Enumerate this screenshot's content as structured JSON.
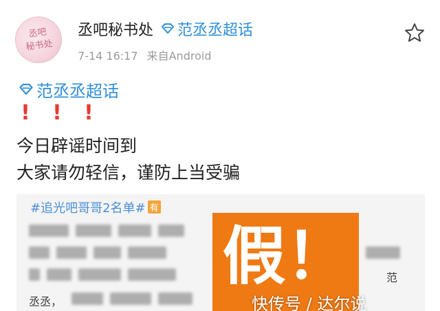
{
  "post": {
    "username": "丞吧秘书处",
    "topic_inline": "范丞丞超话",
    "time": "7-14 16:17",
    "source": "来自Android",
    "avatar_text": [
      "丞吧",
      "秘书处"
    ],
    "topic_tag": "范丞丞超话",
    "alert_marks": [
      "!",
      "!",
      "!"
    ],
    "lines": [
      "今日辟谣时间到",
      "大家请勿轻信，谨防上当受骗"
    ]
  },
  "image": {
    "title": "#追光吧哥哥2名单#",
    "badge": "有",
    "fan_text_right": "范",
    "fan_text_left": "丞丞，",
    "stamp_text": "假！",
    "stamp_color": "#ef7a14",
    "watermark": "快传号 / 达尔说"
  },
  "colors": {
    "accent_blue": "#2f8fd8",
    "alert_red": "#e53b34",
    "meta_gray": "#9a9a9a"
  },
  "icons": {
    "topic": "diamond-topic-icon",
    "favorite": "star-outline-icon"
  }
}
